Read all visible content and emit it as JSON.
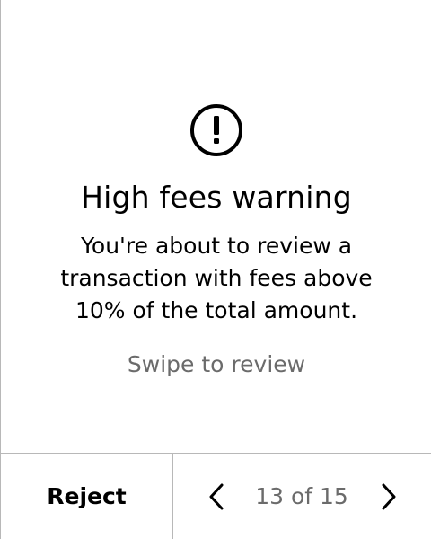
{
  "screen": {
    "icon": "exclamation-circle-icon",
    "title": "High fees warning",
    "message": "You're about to review a\ntransaction with fees above\n10% of the total amount.",
    "hint": "Swipe to review"
  },
  "footer": {
    "reject_label": "Reject",
    "prev_icon": "chevron-left-icon",
    "next_icon": "chevron-right-icon",
    "page_counter": "13 of 15"
  },
  "colors": {
    "text": "#000000",
    "secondary_text": "#6b6b6b",
    "divider": "#b8b8b8",
    "background": "#ffffff"
  }
}
